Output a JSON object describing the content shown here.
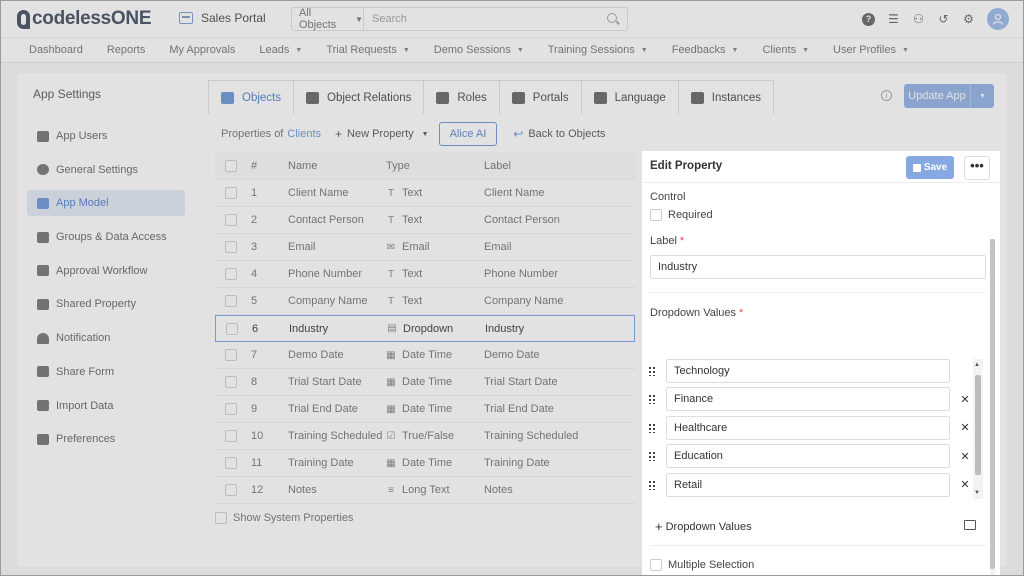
{
  "topbar": {
    "logo_text": "codelessONE",
    "portal_name": "Sales Portal",
    "search_scope": "All Objects",
    "search_placeholder": "Search"
  },
  "nav": [
    "Dashboard",
    "Reports",
    "My Approvals",
    "Leads",
    "Trial Requests",
    "Demo Sessions",
    "Training Sessions",
    "Feedbacks",
    "Clients",
    "User Profiles"
  ],
  "nav_dropdown": [
    false,
    false,
    false,
    true,
    true,
    true,
    true,
    true,
    true,
    true
  ],
  "sidebar": {
    "title": "App Settings",
    "items": [
      {
        "label": "App Users",
        "icon": "users-icon"
      },
      {
        "label": "General Settings",
        "icon": "gear-icon"
      },
      {
        "label": "App Model",
        "icon": "cube-icon",
        "active": true
      },
      {
        "label": "Groups & Data Access",
        "icon": "group-icon"
      },
      {
        "label": "Approval Workflow",
        "icon": "checklist-icon"
      },
      {
        "label": "Shared Property",
        "icon": "shared-icon"
      },
      {
        "label": "Notification",
        "icon": "bell-icon"
      },
      {
        "label": "Share Form",
        "icon": "form-icon"
      },
      {
        "label": "Import Data",
        "icon": "cloud-upload-icon"
      },
      {
        "label": "Preferences",
        "icon": "preferences-icon"
      }
    ]
  },
  "tabs": [
    {
      "label": "Objects",
      "active": true
    },
    {
      "label": "Object Relations"
    },
    {
      "label": "Roles"
    },
    {
      "label": "Portals"
    },
    {
      "label": "Language"
    },
    {
      "label": "Instances"
    }
  ],
  "update_button": "Update App",
  "properties_bar": {
    "prefix": "Properties of",
    "object": "Clients",
    "new_property": "New Property",
    "alice": "Alice AI",
    "back": "Back to Objects"
  },
  "table": {
    "headers": {
      "num": "#",
      "name": "Name",
      "type": "Type",
      "label": "Label"
    },
    "rows": [
      {
        "num": "1",
        "name": "Client Name",
        "type": "Text",
        "type_icon": "T",
        "label": "Client Name"
      },
      {
        "num": "2",
        "name": "Contact Person",
        "type": "Text",
        "type_icon": "T",
        "label": "Contact Person"
      },
      {
        "num": "3",
        "name": "Email",
        "type": "Email",
        "type_icon": "✉",
        "label": "Email"
      },
      {
        "num": "4",
        "name": "Phone Number",
        "type": "Text",
        "type_icon": "T",
        "label": "Phone Number"
      },
      {
        "num": "5",
        "name": "Company Name",
        "type": "Text",
        "type_icon": "T",
        "label": "Company Name"
      },
      {
        "num": "6",
        "name": "Industry",
        "type": "Dropdown",
        "type_icon": "▤",
        "label": "Industry",
        "selected": true
      },
      {
        "num": "7",
        "name": "Demo Date",
        "type": "Date Time",
        "type_icon": "▦",
        "label": "Demo Date"
      },
      {
        "num": "8",
        "name": "Trial Start Date",
        "type": "Date Time",
        "type_icon": "▦",
        "label": "Trial Start Date"
      },
      {
        "num": "9",
        "name": "Trial End Date",
        "type": "Date Time",
        "type_icon": "▦",
        "label": "Trial End Date"
      },
      {
        "num": "10",
        "name": "Training Scheduled",
        "type": "True/False",
        "type_icon": "☑",
        "label": "Training Scheduled"
      },
      {
        "num": "11",
        "name": "Training Date",
        "type": "Date Time",
        "type_icon": "▦",
        "label": "Training Date"
      },
      {
        "num": "12",
        "name": "Notes",
        "type": "Long Text",
        "type_icon": "≡",
        "label": "Notes"
      }
    ],
    "show_system": "Show System Properties"
  },
  "edit": {
    "title": "Edit Property",
    "save": "Save",
    "more": "•••",
    "control_label": "Control",
    "required_label": "Required",
    "label_label": "Label",
    "label_value": "Industry",
    "dropdown_label": "Dropdown Values",
    "values": [
      "Technology",
      "Finance",
      "Healthcare",
      "Education",
      "Retail"
    ],
    "add_values": "Dropdown Values",
    "multiple": "Multiple Selection"
  }
}
